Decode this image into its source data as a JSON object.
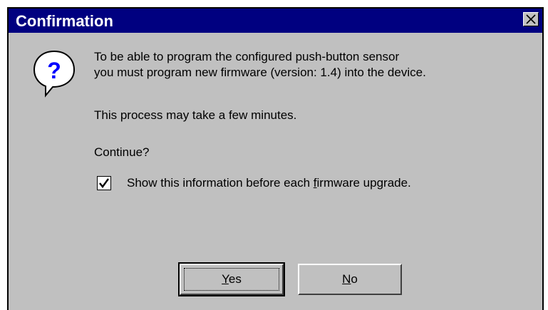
{
  "window": {
    "title": "Confirmation"
  },
  "icons": {
    "close": "close-icon",
    "question": "question-icon",
    "check": "check-icon"
  },
  "message": {
    "line1": "To be able to program the configured push-button sensor",
    "line2": "you must program new firmware (version: 1.4) into the device.",
    "line3": "This process may take a few minutes.",
    "line4": "Continue?"
  },
  "checkbox": {
    "checked": true,
    "label_before": "Show this information before each ",
    "label_mnemonic": "f",
    "label_after": "irmware upgrade."
  },
  "buttons": {
    "yes": {
      "mnemonic": "Y",
      "rest": "es"
    },
    "no": {
      "mnemonic": "N",
      "rest": "o"
    }
  },
  "colors": {
    "titlebar": "#000080",
    "face": "#c0c0c0",
    "icon_accent": "#0000ff"
  }
}
